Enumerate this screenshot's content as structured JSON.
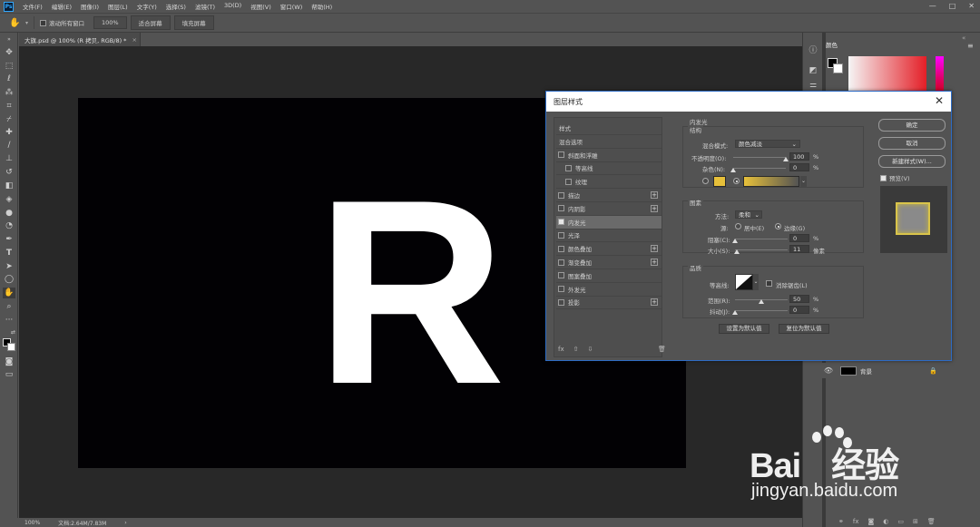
{
  "app": {
    "logo": "Ps",
    "menu": [
      "文件(F)",
      "编辑(E)",
      "图像(I)",
      "图层(L)",
      "文字(Y)",
      "选择(S)",
      "滤镜(T)",
      "3D(D)",
      "视图(V)",
      "窗口(W)",
      "帮助(H)"
    ],
    "window_controls": [
      "—",
      "□",
      "✕"
    ]
  },
  "options_bar": {
    "scroll_all_label": "滚动所有窗口",
    "buttons": [
      "100%",
      "适合屏幕",
      "填充屏幕"
    ]
  },
  "document": {
    "tab_title": "大旗.psd @ 100% (R 拷贝, RGB/8) *",
    "tab_close": "×",
    "canvas_text": "R",
    "background_color": "#020104",
    "text_color": "#ffffff"
  },
  "status_bar": {
    "zoom": "100%",
    "doc_info": "文档:2.64M/7.83M",
    "arrow": "›"
  },
  "right_panels": {
    "color_tab": "颜色",
    "collapse": "«",
    "menu": "≡",
    "brand_red": "#e41f27",
    "layer": {
      "name": "背景",
      "visible_icon": "eye-icon",
      "lock_icon": "lock-icon"
    },
    "footer_icons": [
      "link-icon",
      "fx-icon",
      "mask-icon",
      "adjustment-icon",
      "folder-icon",
      "new-layer-icon",
      "trash-icon"
    ]
  },
  "dialog": {
    "title": "图层样式",
    "close": "✕",
    "style_list": [
      {
        "label": "样式",
        "checkbox": false,
        "checked": false,
        "plus": false,
        "indent": 0
      },
      {
        "label": "混合选项",
        "checkbox": false,
        "checked": false,
        "plus": false,
        "indent": 0
      },
      {
        "label": "斜面和浮雕",
        "checkbox": true,
        "checked": false,
        "plus": false,
        "indent": 0
      },
      {
        "label": "等高线",
        "checkbox": true,
        "checked": false,
        "plus": false,
        "indent": 1
      },
      {
        "label": "纹理",
        "checkbox": true,
        "checked": false,
        "plus": false,
        "indent": 1
      },
      {
        "label": "描边",
        "checkbox": true,
        "checked": false,
        "plus": true,
        "indent": 0
      },
      {
        "label": "内阴影",
        "checkbox": true,
        "checked": false,
        "plus": true,
        "indent": 0
      },
      {
        "label": "内发光",
        "checkbox": true,
        "checked": true,
        "plus": false,
        "indent": 0,
        "selected": true
      },
      {
        "label": "光泽",
        "checkbox": true,
        "checked": false,
        "plus": false,
        "indent": 0
      },
      {
        "label": "颜色叠加",
        "checkbox": true,
        "checked": false,
        "plus": true,
        "indent": 0
      },
      {
        "label": "渐变叠加",
        "checkbox": true,
        "checked": false,
        "plus": true,
        "indent": 0
      },
      {
        "label": "图案叠加",
        "checkbox": true,
        "checked": false,
        "plus": false,
        "indent": 0
      },
      {
        "label": "外发光",
        "checkbox": true,
        "checked": false,
        "plus": false,
        "indent": 0
      },
      {
        "label": "投影",
        "checkbox": true,
        "checked": false,
        "plus": true,
        "indent": 0
      }
    ],
    "list_footer": [
      "fx",
      "⇧",
      "⇩",
      "🗑"
    ],
    "inner_glow": {
      "section_title": "内发光",
      "structure_title": "结构",
      "blend_mode_label": "混合模式:",
      "blend_mode_value": "颜色减淡",
      "opacity_label": "不透明度(O):",
      "opacity_value": "100",
      "opacity_unit": "%",
      "opacity_level": 1.0,
      "noise_label": "杂色(N):",
      "noise_value": "0",
      "noise_unit": "%",
      "noise_level": 0,
      "glow_color": "#e7c03a",
      "elements_title": "图素",
      "method_label": "方法:",
      "method_value": "柔和",
      "source_label": "源:",
      "source_center": "居中(E)",
      "source_edge": "边缘(G)",
      "choke_label": "阻塞(C):",
      "choke_value": "0",
      "choke_unit": "%",
      "choke_level": 0,
      "size_label": "大小(S):",
      "size_value": "11",
      "size_unit": "像素",
      "size_level": 0.04,
      "quality_title": "品质",
      "contour_label": "等高线:",
      "antialias_label": "消除锯齿(L)",
      "range_label": "范围(R):",
      "range_value": "50",
      "range_unit": "%",
      "range_level": 0.5,
      "jitter_label": "抖动(J):",
      "jitter_value": "0",
      "jitter_unit": "%",
      "jitter_level": 0,
      "set_default": "设置为默认值",
      "reset_default": "复位为默认值"
    },
    "buttons": {
      "ok": "确定",
      "cancel": "取消",
      "new_style": "新建样式(W)...",
      "preview": "预览(V)"
    }
  },
  "watermark": {
    "brand": "Bai",
    "brand_tail": "经验",
    "url": "jingyan.baidu.com"
  }
}
